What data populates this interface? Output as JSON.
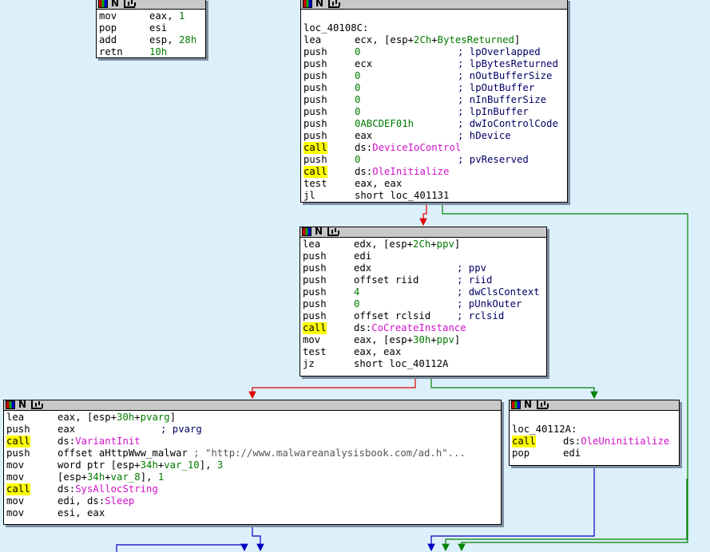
{
  "block_top_left": {
    "lines": [
      {
        "mnem": "mov",
        "ops": [
          {
            "t": "eax, "
          },
          {
            "t": "1",
            "c": "num"
          }
        ]
      },
      {
        "mnem": "pop",
        "ops": [
          {
            "t": "esi"
          }
        ]
      },
      {
        "mnem": "add",
        "ops": [
          {
            "t": "esp, "
          },
          {
            "t": "28h",
            "c": "num"
          }
        ]
      },
      {
        "mnem": "retn",
        "ops": [
          {
            "t": "10h",
            "c": "num"
          }
        ]
      }
    ]
  },
  "block_top_right": {
    "label": "loc_40108C:",
    "lines": [
      {
        "mnem": "lea",
        "ops": [
          {
            "t": "ecx, [esp+"
          },
          {
            "t": "2Ch",
            "c": "num"
          },
          {
            "t": "+"
          },
          {
            "t": "BytesReturned",
            "c": "arg"
          },
          {
            "t": "]"
          }
        ]
      },
      {
        "mnem": "push",
        "ops": [
          {
            "t": "0",
            "c": "num"
          }
        ],
        "cmt": "; lpOverlapped"
      },
      {
        "mnem": "push",
        "ops": [
          {
            "t": "ecx"
          }
        ],
        "cmt": "; lpBytesReturned"
      },
      {
        "mnem": "push",
        "ops": [
          {
            "t": "0",
            "c": "num"
          }
        ],
        "cmt": "; nOutBufferSize"
      },
      {
        "mnem": "push",
        "ops": [
          {
            "t": "0",
            "c": "num"
          }
        ],
        "cmt": "; lpOutBuffer"
      },
      {
        "mnem": "push",
        "ops": [
          {
            "t": "0",
            "c": "num"
          }
        ],
        "cmt": "; nInBufferSize"
      },
      {
        "mnem": "push",
        "ops": [
          {
            "t": "0",
            "c": "num"
          }
        ],
        "cmt": "; lpInBuffer"
      },
      {
        "mnem": "push",
        "ops": [
          {
            "t": "0ABCDEF01h",
            "c": "num"
          }
        ],
        "cmt": "; dwIoControlCode"
      },
      {
        "mnem": "push",
        "ops": [
          {
            "t": "eax"
          }
        ],
        "cmt": "; hDevice"
      },
      {
        "mnem": "call",
        "ops": [
          {
            "t": "ds:"
          },
          {
            "t": "DeviceIoControl",
            "c": "api"
          }
        ],
        "call": true
      },
      {
        "mnem": "push",
        "ops": [
          {
            "t": "0",
            "c": "num"
          }
        ],
        "cmt": "; pvReserved"
      },
      {
        "mnem": "call",
        "ops": [
          {
            "t": "ds:"
          },
          {
            "t": "OleInitialize",
            "c": "api"
          }
        ],
        "call": true
      },
      {
        "mnem": "test",
        "ops": [
          {
            "t": "eax, eax"
          }
        ]
      },
      {
        "mnem": "jl",
        "ops": [
          {
            "t": "short loc_401131"
          }
        ]
      }
    ]
  },
  "block_middle": {
    "lines": [
      {
        "mnem": "lea",
        "ops": [
          {
            "t": "edx, [esp+"
          },
          {
            "t": "2Ch",
            "c": "num"
          },
          {
            "t": "+"
          },
          {
            "t": "ppv",
            "c": "arg"
          },
          {
            "t": "]"
          }
        ]
      },
      {
        "mnem": "push",
        "ops": [
          {
            "t": "edi"
          }
        ]
      },
      {
        "mnem": "push",
        "ops": [
          {
            "t": "edx"
          }
        ],
        "cmt": "; ppv"
      },
      {
        "mnem": "push",
        "ops": [
          {
            "t": "offset riid"
          }
        ],
        "cmt": "; riid"
      },
      {
        "mnem": "push",
        "ops": [
          {
            "t": "4",
            "c": "num"
          }
        ],
        "cmt": "; dwClsContext"
      },
      {
        "mnem": "push",
        "ops": [
          {
            "t": "0",
            "c": "num"
          }
        ],
        "cmt": "; pUnkOuter"
      },
      {
        "mnem": "push",
        "ops": [
          {
            "t": "offset rclsid"
          }
        ],
        "cmt": "; rclsid"
      },
      {
        "mnem": "call",
        "ops": [
          {
            "t": "ds:"
          },
          {
            "t": "CoCreateInstance",
            "c": "api"
          }
        ],
        "call": true
      },
      {
        "mnem": "mov",
        "ops": [
          {
            "t": "eax, [esp+"
          },
          {
            "t": "30h",
            "c": "num"
          },
          {
            "t": "+"
          },
          {
            "t": "ppv",
            "c": "arg"
          },
          {
            "t": "]"
          }
        ]
      },
      {
        "mnem": "test",
        "ops": [
          {
            "t": "eax, eax"
          }
        ]
      },
      {
        "mnem": "jz",
        "ops": [
          {
            "t": "short loc_40112A"
          }
        ]
      }
    ]
  },
  "block_bottom_left": {
    "lines": [
      {
        "mnem": "lea",
        "ops": [
          {
            "t": "eax, [esp+"
          },
          {
            "t": "30h",
            "c": "num"
          },
          {
            "t": "+"
          },
          {
            "t": "pvarg",
            "c": "arg"
          },
          {
            "t": "]"
          }
        ]
      },
      {
        "mnem": "push",
        "ops": [
          {
            "t": "eax"
          }
        ],
        "cmt": "; pvarg"
      },
      {
        "mnem": "call",
        "ops": [
          {
            "t": "ds:"
          },
          {
            "t": "VariantInit",
            "c": "api"
          }
        ],
        "call": true
      },
      {
        "mnem": "push",
        "ops": [
          {
            "t": "offset aHttpWww_malwar "
          },
          {
            "t": "; \"http://www.malwareanalysisbook.com/ad.h\"...",
            "c": "str"
          }
        ]
      },
      {
        "mnem": "mov",
        "ops": [
          {
            "t": "word ptr [esp+"
          },
          {
            "t": "34h",
            "c": "num"
          },
          {
            "t": "+"
          },
          {
            "t": "var_10",
            "c": "arg"
          },
          {
            "t": "], "
          },
          {
            "t": "3",
            "c": "num"
          }
        ]
      },
      {
        "mnem": "mov",
        "ops": [
          {
            "t": "[esp+"
          },
          {
            "t": "34h",
            "c": "num"
          },
          {
            "t": "+"
          },
          {
            "t": "var_8",
            "c": "arg"
          },
          {
            "t": "], "
          },
          {
            "t": "1",
            "c": "num"
          }
        ]
      },
      {
        "mnem": "call",
        "ops": [
          {
            "t": "ds:"
          },
          {
            "t": "SysAllocString",
            "c": "api"
          }
        ],
        "call": true
      },
      {
        "mnem": "mov",
        "ops": [
          {
            "t": "edi, ds:"
          },
          {
            "t": "Sleep",
            "c": "api"
          }
        ]
      },
      {
        "mnem": "mov",
        "ops": [
          {
            "t": "esi, eax"
          }
        ]
      }
    ]
  },
  "block_bottom_right": {
    "label": "loc_40112A:",
    "lines": [
      {
        "mnem": "call",
        "ops": [
          {
            "t": "ds:"
          },
          {
            "t": "OleUninitialize",
            "c": "api"
          }
        ],
        "call": true
      },
      {
        "mnem": "pop",
        "ops": [
          {
            "t": "edi"
          }
        ]
      }
    ]
  },
  "colors": {
    "background": "#dcf0fc",
    "true_edge": "#008000",
    "false_edge": "#e00000",
    "plain_edge": "#0000c0"
  }
}
